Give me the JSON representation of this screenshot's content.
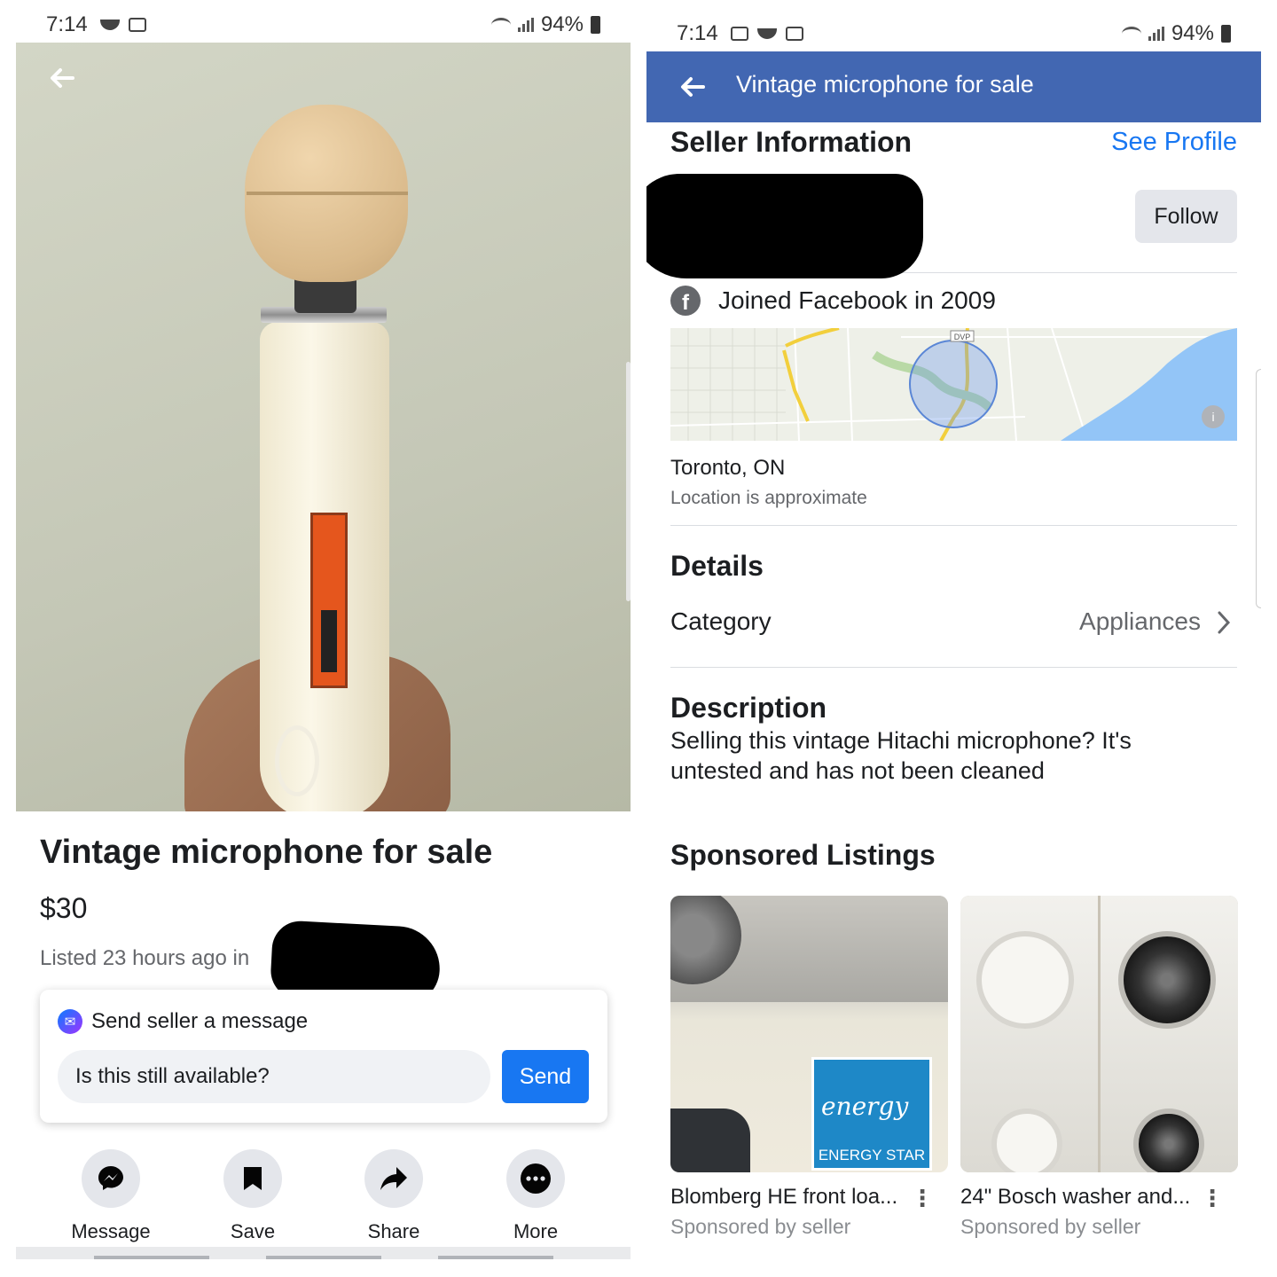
{
  "left": {
    "status": {
      "time": "7:14",
      "battery": "94%"
    },
    "listing": {
      "title": "Vintage microphone for sale",
      "price": "$30",
      "listed": "Listed 23 hours ago in"
    },
    "message_card": {
      "header": "Send seller a message",
      "input_value": "Is this still available?",
      "send_label": "Send"
    },
    "actions": [
      {
        "label": "Message",
        "icon": "messenger-icon"
      },
      {
        "label": "Save",
        "icon": "bookmark-icon"
      },
      {
        "label": "Share",
        "icon": "share-icon"
      },
      {
        "label": "More",
        "icon": "more-icon"
      }
    ]
  },
  "right": {
    "status": {
      "time": "7:14",
      "battery": "94%"
    },
    "appbar": {
      "title": "Vintage microphone for sale"
    },
    "seller": {
      "heading": "Seller Information",
      "see_profile": "See Profile",
      "follow": "Follow",
      "joined": "Joined Facebook in 2009"
    },
    "location": {
      "map_label": "DVP",
      "city": "Toronto, ON",
      "note": "Location is approximate"
    },
    "details": {
      "heading": "Details",
      "category_label": "Category",
      "category_value": "Appliances"
    },
    "description": {
      "heading": "Description",
      "text": "Selling this vintage Hitachi microphone?  It's untested and has not been cleaned"
    },
    "sponsored": {
      "heading": "Sponsored Listings",
      "items": [
        {
          "name": "Blomberg HE front loa...",
          "sub": "Sponsored by seller",
          "badge": "ENERGY STAR",
          "badge_word": "energy"
        },
        {
          "name": "24\" Bosch washer and...",
          "sub": "Sponsored by seller"
        }
      ]
    }
  },
  "colors": {
    "facebook_blue": "#4267b2",
    "link_blue": "#1877f2",
    "secondary_text": "#65676b"
  }
}
